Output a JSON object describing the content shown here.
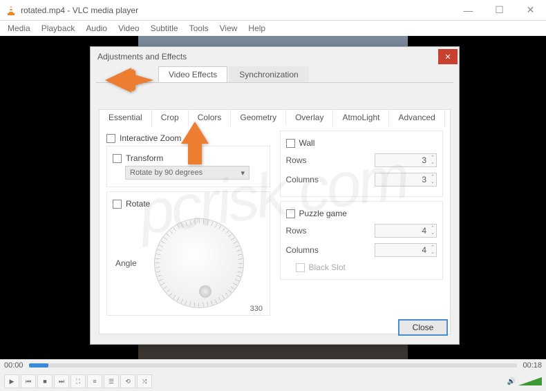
{
  "window": {
    "title": "rotated.mp4 - VLC media player",
    "controls": {
      "min": "—",
      "max": "☐",
      "close": "✕"
    }
  },
  "menubar": [
    "Media",
    "Playback",
    "Audio",
    "Video",
    "Subtitle",
    "Tools",
    "View",
    "Help"
  ],
  "dialog": {
    "title": "Adjustments and Effects",
    "main_tabs": [
      "Video Effects",
      "Synchronization"
    ],
    "sub_tabs": [
      "Essential",
      "Crop",
      "Colors",
      "Geometry",
      "Overlay",
      "AtmoLight",
      "Advanced"
    ],
    "geometry": {
      "interactive_zoom": "Interactive Zoom",
      "transform": "Transform",
      "transform_select": "Rotate by 90 degrees",
      "rotate": "Rotate",
      "angle_label": "Angle",
      "angle_value": "330",
      "wall": "Wall",
      "rows": "Rows",
      "columns": "Columns",
      "wall_rows": "3",
      "wall_cols": "3",
      "puzzle": "Puzzle game",
      "puzzle_rows": "4",
      "puzzle_cols": "4",
      "black_slot": "Black Slot"
    },
    "close_btn": "Close"
  },
  "player": {
    "time_current": "00:00",
    "time_total": "00:18"
  }
}
